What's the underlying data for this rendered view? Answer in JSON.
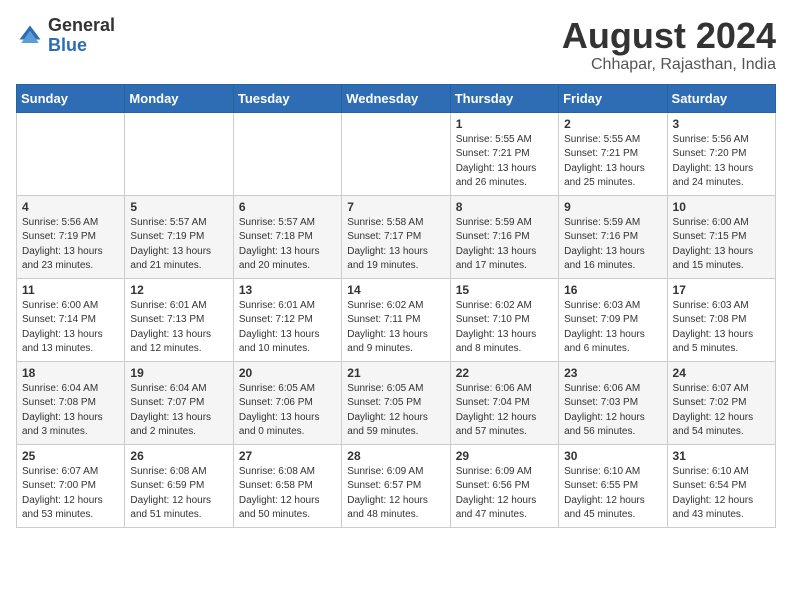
{
  "header": {
    "logo_general": "General",
    "logo_blue": "Blue",
    "main_title": "August 2024",
    "subtitle": "Chhapar, Rajasthan, India"
  },
  "weekdays": [
    "Sunday",
    "Monday",
    "Tuesday",
    "Wednesday",
    "Thursday",
    "Friday",
    "Saturday"
  ],
  "weeks": [
    [
      {
        "day": "",
        "info": ""
      },
      {
        "day": "",
        "info": ""
      },
      {
        "day": "",
        "info": ""
      },
      {
        "day": "",
        "info": ""
      },
      {
        "day": "1",
        "info": "Sunrise: 5:55 AM\nSunset: 7:21 PM\nDaylight: 13 hours\nand 26 minutes."
      },
      {
        "day": "2",
        "info": "Sunrise: 5:55 AM\nSunset: 7:21 PM\nDaylight: 13 hours\nand 25 minutes."
      },
      {
        "day": "3",
        "info": "Sunrise: 5:56 AM\nSunset: 7:20 PM\nDaylight: 13 hours\nand 24 minutes."
      }
    ],
    [
      {
        "day": "4",
        "info": "Sunrise: 5:56 AM\nSunset: 7:19 PM\nDaylight: 13 hours\nand 23 minutes."
      },
      {
        "day": "5",
        "info": "Sunrise: 5:57 AM\nSunset: 7:19 PM\nDaylight: 13 hours\nand 21 minutes."
      },
      {
        "day": "6",
        "info": "Sunrise: 5:57 AM\nSunset: 7:18 PM\nDaylight: 13 hours\nand 20 minutes."
      },
      {
        "day": "7",
        "info": "Sunrise: 5:58 AM\nSunset: 7:17 PM\nDaylight: 13 hours\nand 19 minutes."
      },
      {
        "day": "8",
        "info": "Sunrise: 5:59 AM\nSunset: 7:16 PM\nDaylight: 13 hours\nand 17 minutes."
      },
      {
        "day": "9",
        "info": "Sunrise: 5:59 AM\nSunset: 7:16 PM\nDaylight: 13 hours\nand 16 minutes."
      },
      {
        "day": "10",
        "info": "Sunrise: 6:00 AM\nSunset: 7:15 PM\nDaylight: 13 hours\nand 15 minutes."
      }
    ],
    [
      {
        "day": "11",
        "info": "Sunrise: 6:00 AM\nSunset: 7:14 PM\nDaylight: 13 hours\nand 13 minutes."
      },
      {
        "day": "12",
        "info": "Sunrise: 6:01 AM\nSunset: 7:13 PM\nDaylight: 13 hours\nand 12 minutes."
      },
      {
        "day": "13",
        "info": "Sunrise: 6:01 AM\nSunset: 7:12 PM\nDaylight: 13 hours\nand 10 minutes."
      },
      {
        "day": "14",
        "info": "Sunrise: 6:02 AM\nSunset: 7:11 PM\nDaylight: 13 hours\nand 9 minutes."
      },
      {
        "day": "15",
        "info": "Sunrise: 6:02 AM\nSunset: 7:10 PM\nDaylight: 13 hours\nand 8 minutes."
      },
      {
        "day": "16",
        "info": "Sunrise: 6:03 AM\nSunset: 7:09 PM\nDaylight: 13 hours\nand 6 minutes."
      },
      {
        "day": "17",
        "info": "Sunrise: 6:03 AM\nSunset: 7:08 PM\nDaylight: 13 hours\nand 5 minutes."
      }
    ],
    [
      {
        "day": "18",
        "info": "Sunrise: 6:04 AM\nSunset: 7:08 PM\nDaylight: 13 hours\nand 3 minutes."
      },
      {
        "day": "19",
        "info": "Sunrise: 6:04 AM\nSunset: 7:07 PM\nDaylight: 13 hours\nand 2 minutes."
      },
      {
        "day": "20",
        "info": "Sunrise: 6:05 AM\nSunset: 7:06 PM\nDaylight: 13 hours\nand 0 minutes."
      },
      {
        "day": "21",
        "info": "Sunrise: 6:05 AM\nSunset: 7:05 PM\nDaylight: 12 hours\nand 59 minutes."
      },
      {
        "day": "22",
        "info": "Sunrise: 6:06 AM\nSunset: 7:04 PM\nDaylight: 12 hours\nand 57 minutes."
      },
      {
        "day": "23",
        "info": "Sunrise: 6:06 AM\nSunset: 7:03 PM\nDaylight: 12 hours\nand 56 minutes."
      },
      {
        "day": "24",
        "info": "Sunrise: 6:07 AM\nSunset: 7:02 PM\nDaylight: 12 hours\nand 54 minutes."
      }
    ],
    [
      {
        "day": "25",
        "info": "Sunrise: 6:07 AM\nSunset: 7:00 PM\nDaylight: 12 hours\nand 53 minutes."
      },
      {
        "day": "26",
        "info": "Sunrise: 6:08 AM\nSunset: 6:59 PM\nDaylight: 12 hours\nand 51 minutes."
      },
      {
        "day": "27",
        "info": "Sunrise: 6:08 AM\nSunset: 6:58 PM\nDaylight: 12 hours\nand 50 minutes."
      },
      {
        "day": "28",
        "info": "Sunrise: 6:09 AM\nSunset: 6:57 PM\nDaylight: 12 hours\nand 48 minutes."
      },
      {
        "day": "29",
        "info": "Sunrise: 6:09 AM\nSunset: 6:56 PM\nDaylight: 12 hours\nand 47 minutes."
      },
      {
        "day": "30",
        "info": "Sunrise: 6:10 AM\nSunset: 6:55 PM\nDaylight: 12 hours\nand 45 minutes."
      },
      {
        "day": "31",
        "info": "Sunrise: 6:10 AM\nSunset: 6:54 PM\nDaylight: 12 hours\nand 43 minutes."
      }
    ]
  ]
}
